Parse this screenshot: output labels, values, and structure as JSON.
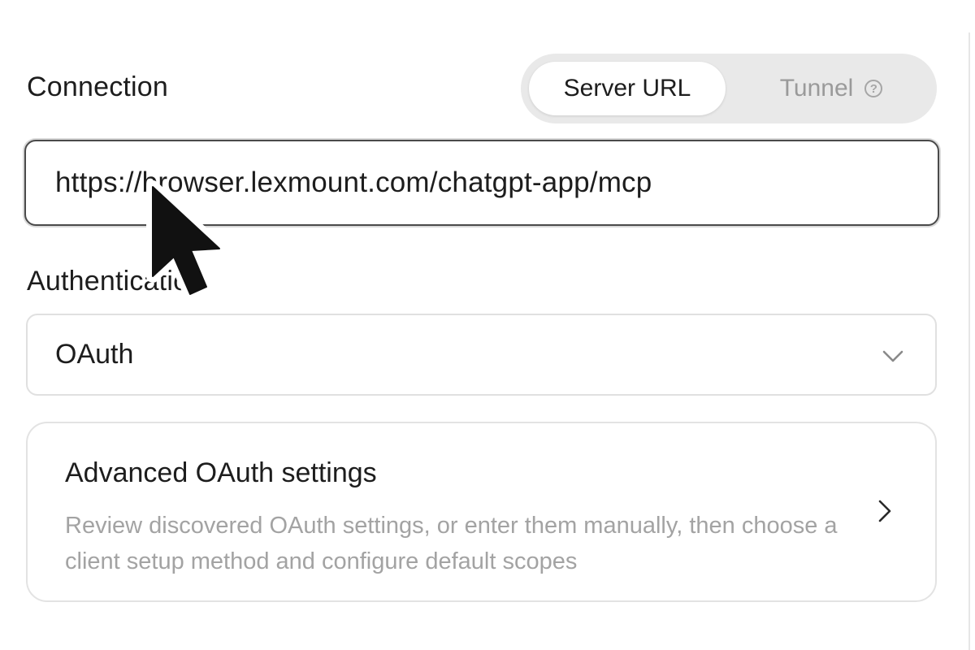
{
  "connection": {
    "title": "Connection",
    "mode_options": [
      {
        "label": "Server URL",
        "selected": true
      },
      {
        "label": "Tunnel",
        "selected": false
      }
    ],
    "help_icon": "question-circle-icon",
    "server_url": "https://browser.lexmount.com/chatgpt-app/mcp"
  },
  "authentication": {
    "title": "Authentication",
    "selected_value": "OAuth",
    "dropdown_icon": "chevron-down-icon"
  },
  "advanced_oauth": {
    "title": "Advanced OAuth settings",
    "description": "Review discovered OAuth settings, or enter them manually, then choose a client setup method and configure default scopes",
    "arrow_icon": "chevron-right-icon"
  },
  "pointer": {
    "icon": "mouse-cursor-arrow-icon"
  },
  "colors": {
    "text_primary": "#1d1d1d",
    "text_secondary": "#a3a3a3",
    "segment_track": "#e9e9e9",
    "input_border_focus": "#4a4a4a",
    "border_light": "#e0e0e0"
  }
}
